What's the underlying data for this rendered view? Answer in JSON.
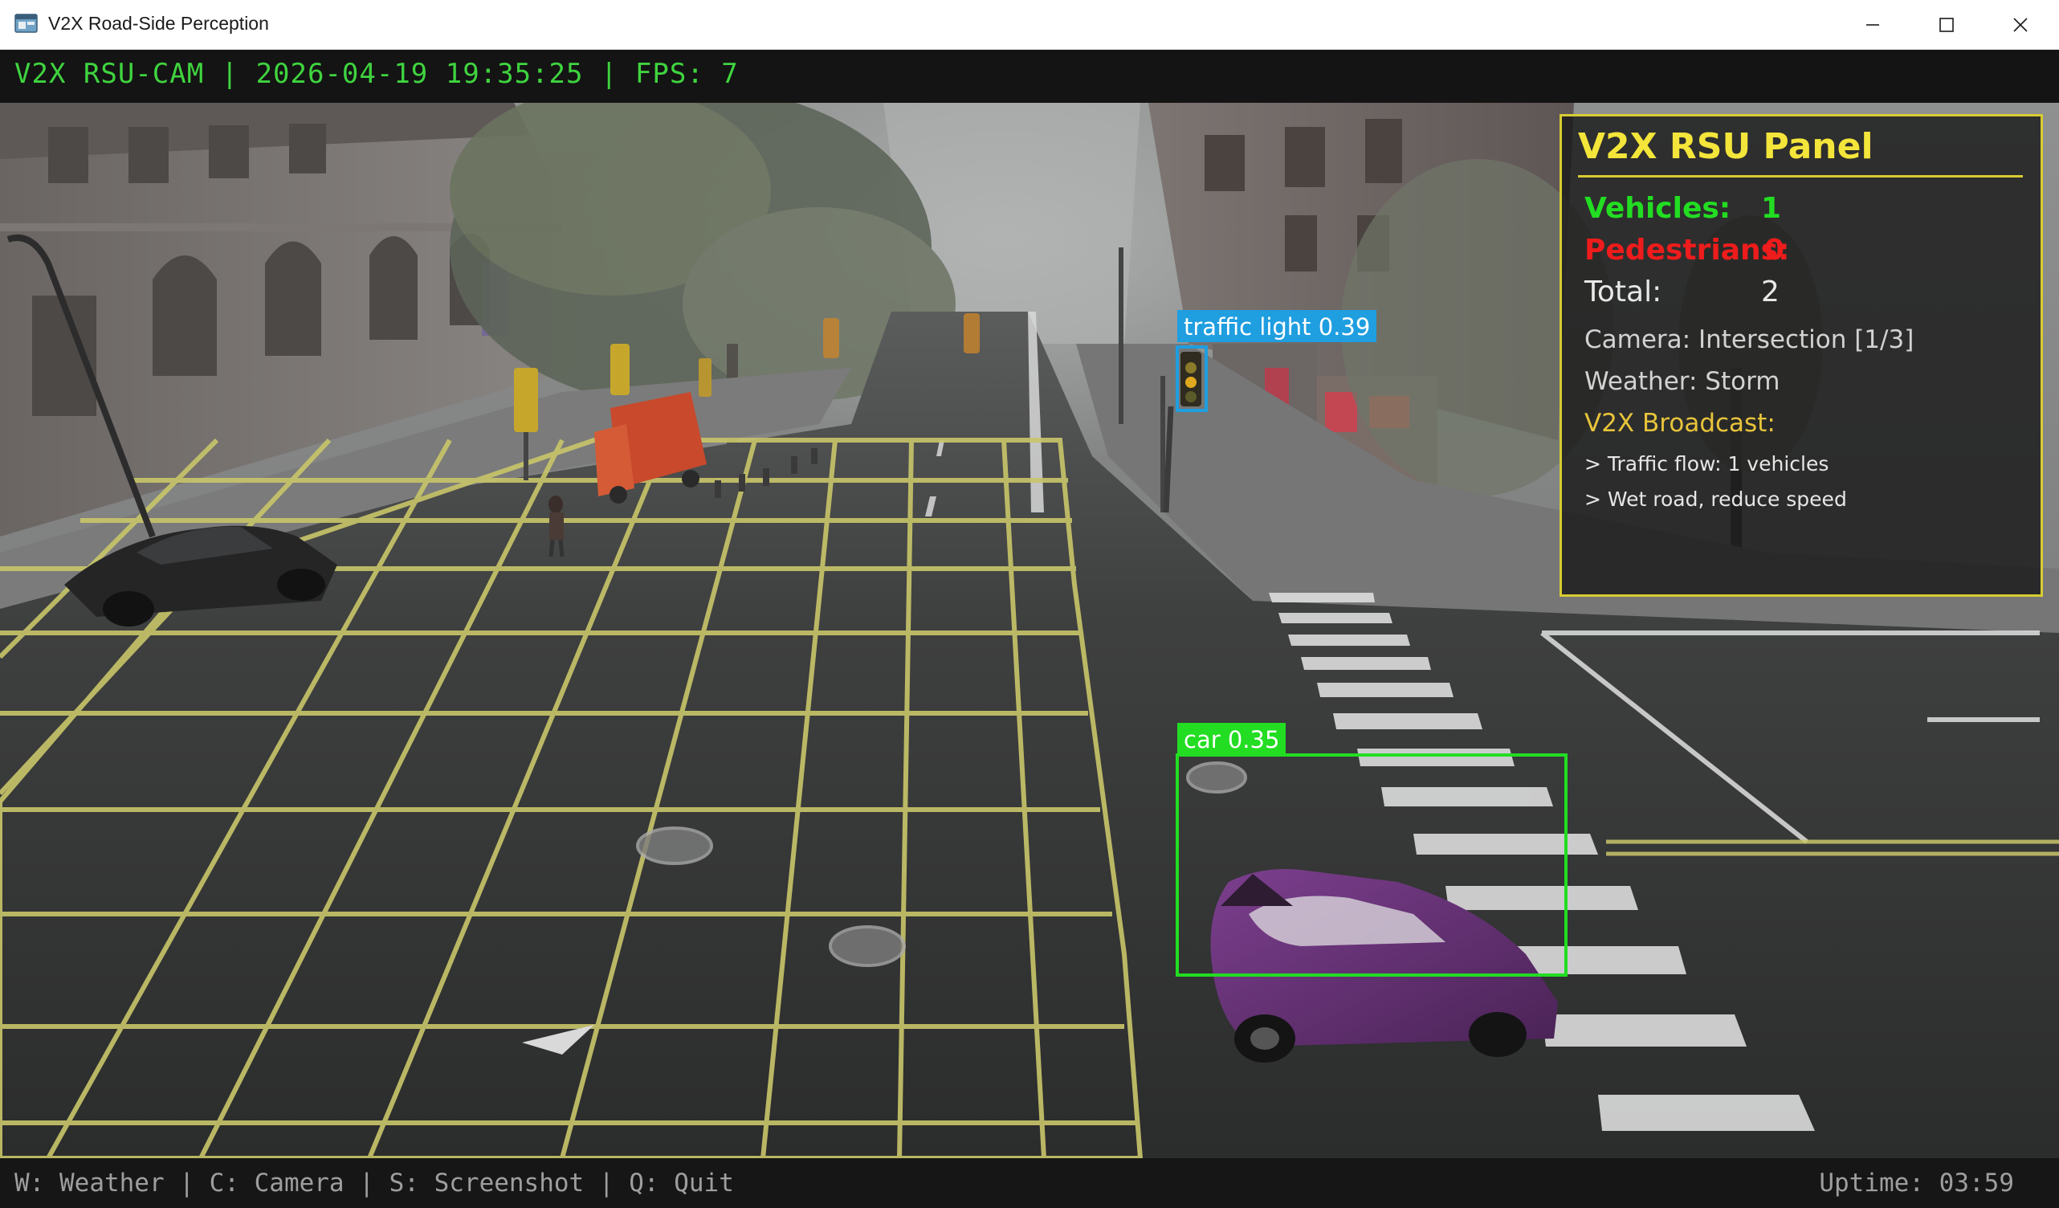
{
  "window": {
    "title": "V2X Road-Side Perception",
    "icon": "app-window-icon",
    "controls": [
      "minimize-icon",
      "maximize-icon",
      "close-icon"
    ]
  },
  "header": {
    "status_text": "V2X RSU-CAM | 2026-04-19 19:35:25 | FPS: 7",
    "color": "#3fd43f"
  },
  "detections": [
    {
      "label": "traffic light 0.39",
      "class": "traffic light",
      "confidence": 0.39,
      "color": "#1f9ee0"
    },
    {
      "label": "car 0.35",
      "class": "car",
      "confidence": 0.35,
      "color": "#22dd22"
    }
  ],
  "panel": {
    "title": "V2X RSU Panel",
    "vehicles_label": "Vehicles:",
    "vehicles_value": "1",
    "pedestrians_label": "Pedestrians:",
    "pedestrians_value": "0",
    "total_label": "Total:",
    "total_value": "2",
    "camera": "Camera: Intersection [1/3]",
    "weather": "Weather: Storm",
    "broadcast_title": "V2X Broadcast:",
    "broadcast_messages": [
      "> Traffic flow: 1 vehicles",
      "> Wet road, reduce speed"
    ],
    "colors": {
      "border": "#d8cc32",
      "title": "#f4e53a",
      "vehicles": "#22dd22",
      "pedestrians": "#ee1c1c",
      "broadcast": "#e8c43a"
    }
  },
  "footer": {
    "shortcuts": "W: Weather | C: Camera | S: Screenshot | Q: Quit",
    "uptime": "Uptime: 03:59"
  }
}
